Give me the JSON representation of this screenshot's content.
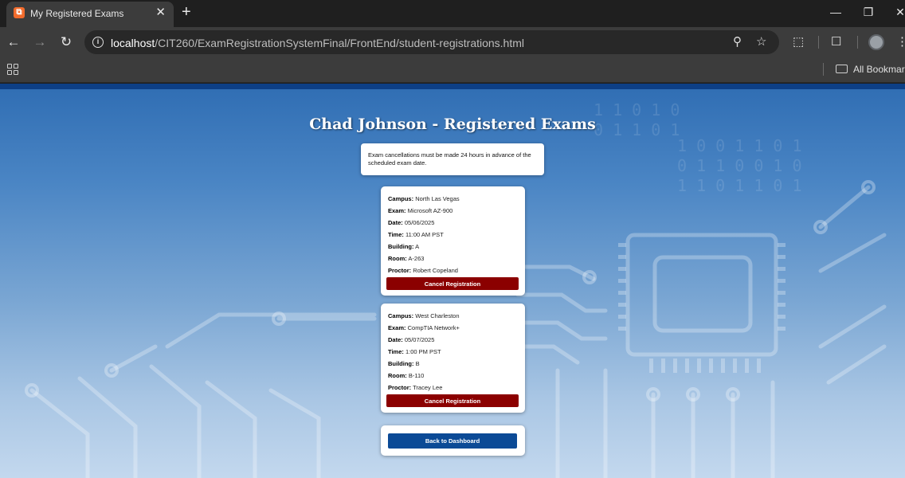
{
  "browser": {
    "tab_title": "My Registered Exams",
    "tab_favicon": "xampp-icon",
    "url_host": "localhost",
    "url_path": "/CIT260/ExamRegistrationSystemFinal/FrontEnd/student-registrations.html",
    "bookmarks_label": "All Bookmarks"
  },
  "page": {
    "title": "Chad Johnson - Registered Exams",
    "notice": "Exam cancellations must be made 24 hours in advance of the scheduled exam date.",
    "field_labels": {
      "campus": "Campus:",
      "exam": "Exam:",
      "date": "Date:",
      "time": "Time:",
      "building": "Building:",
      "room": "Room:",
      "proctor": "Proctor:"
    },
    "exams": [
      {
        "campus": "North Las Vegas",
        "exam": "Microsoft AZ-900",
        "date": "05/06/2025",
        "time": "11:00 AM PST",
        "building": "A",
        "room": "A-263",
        "proctor": "Robert Copeland",
        "cancel_label": "Cancel Registration"
      },
      {
        "campus": "West Charleston",
        "exam": "CompTIA Network+",
        "date": "05/07/2025",
        "time": "1:00 PM PST",
        "building": "B",
        "room": "B-110",
        "proctor": "Tracey Lee",
        "cancel_label": "Cancel Registration"
      }
    ],
    "back_label": "Back to Dashboard"
  },
  "colors": {
    "cancel_button": "#8b0000",
    "back_button": "#0b4a96",
    "header_bar": "#0d3f86"
  }
}
